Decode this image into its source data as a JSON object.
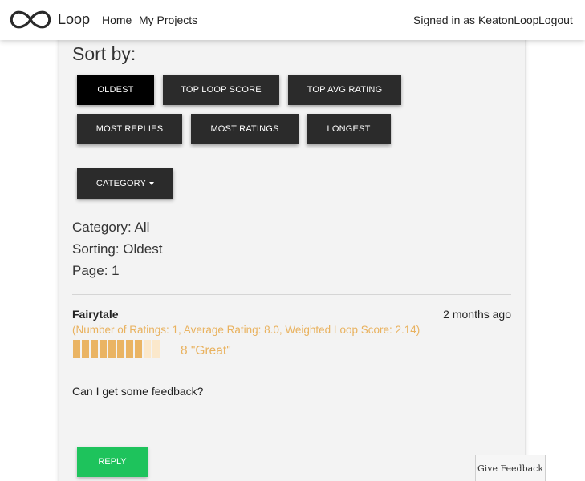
{
  "navbar": {
    "brand": "Loop",
    "links": {
      "home": "Home",
      "my_projects": "My Projects"
    },
    "signed_in": "Signed in as KeatonLoop",
    "logout": "Logout"
  },
  "sort": {
    "title": "Sort by:",
    "buttons": {
      "oldest": "Oldest",
      "top_loop_score": "Top Loop Score",
      "top_avg_rating": "Top Avg Rating",
      "most_replies": "Most Replies",
      "most_ratings": "Most Ratings",
      "longest": "Longest"
    },
    "active": "oldest",
    "category_button": "Category"
  },
  "status": {
    "category": "Category: All",
    "sorting": "Sorting: Oldest",
    "page": "Page: 1"
  },
  "post": {
    "title": "Fairytale",
    "time": "2 months ago",
    "stats": "(Number of Ratings: 1, Average Rating: 8.0, Weighted Loop Score: 2.14)",
    "rating_value": 8,
    "rating_max": 10,
    "rating_label": "8 \"Great\"",
    "body": "Can I get some feedback?",
    "reply_label": "Reply"
  },
  "feedback_button": "Give Feedback",
  "colors": {
    "button_dark": "#2b2b2b",
    "button_active": "#000000",
    "rating_orange": "#e9b25f",
    "reply_green": "#1ec35c"
  }
}
